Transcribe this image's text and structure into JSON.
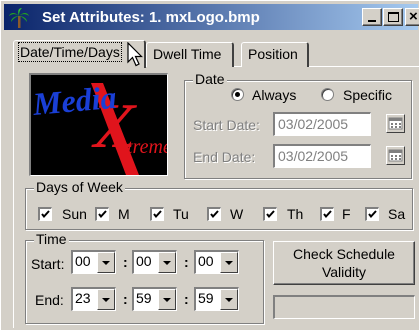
{
  "window": {
    "title": "Set Attributes: 1. mxLogo.bmp",
    "title_icon": "palm-tree-icon",
    "controls": {
      "minimize": "minimize-icon",
      "maximize": "maximize-icon",
      "close": "close-icon"
    }
  },
  "tabs": [
    {
      "label": "Date/Time/Days",
      "active": true
    },
    {
      "label": "Dwell Time",
      "active": false
    },
    {
      "label": "Position",
      "active": false
    }
  ],
  "logo": {
    "line1": "Media",
    "line2": "X",
    "line3": "treme",
    "colors": {
      "background": "#000000",
      "blue": "#1a3fd6",
      "red": "#e0141c"
    }
  },
  "date_group": {
    "title": "Date",
    "options": [
      {
        "label": "Always",
        "selected": true
      },
      {
        "label": "Specific",
        "selected": false
      }
    ],
    "start_date": {
      "label": "Start Date:",
      "value": "03/02/2005"
    },
    "end_date": {
      "label": "End Date:",
      "value": "03/02/2005"
    },
    "calendar_icon": "calendar-icon"
  },
  "days_group": {
    "title": "Days of Week",
    "days": [
      {
        "label": "Sun",
        "checked": true
      },
      {
        "label": "M",
        "checked": true
      },
      {
        "label": "Tu",
        "checked": true
      },
      {
        "label": "W",
        "checked": true
      },
      {
        "label": "Th",
        "checked": true
      },
      {
        "label": "F",
        "checked": true
      },
      {
        "label": "Sa",
        "checked": true
      }
    ]
  },
  "time_group": {
    "title": "Time",
    "separator": ":",
    "start": {
      "label": "Start:",
      "hour": "00",
      "minute": "00",
      "second": "00"
    },
    "end": {
      "label": "End:",
      "hour": "23",
      "minute": "59",
      "second": "59"
    }
  },
  "check_button": {
    "line1": "Check Schedule",
    "line2": "Validity"
  },
  "status_text": ""
}
